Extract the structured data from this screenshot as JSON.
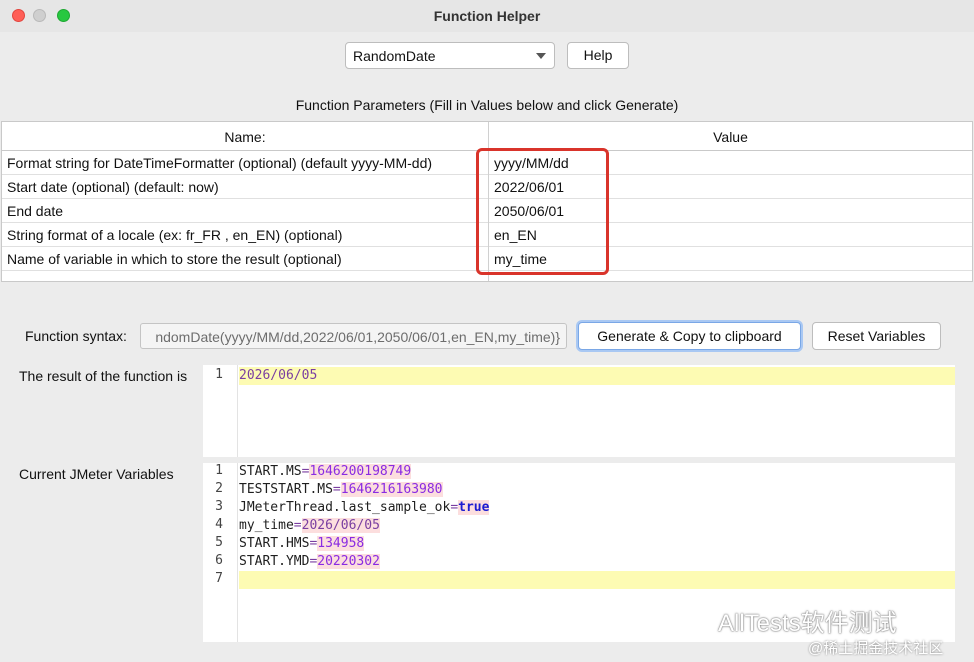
{
  "window": {
    "title": "Function Helper"
  },
  "function_select": {
    "value": "RandomDate"
  },
  "buttons": {
    "help": "Help",
    "generate": "Generate & Copy to clipboard",
    "reset": "Reset Variables"
  },
  "params": {
    "caption": "Function Parameters (Fill in Values below and click Generate)",
    "header_name": "Name:",
    "header_value": "Value",
    "rows": [
      {
        "name": "Format string for DateTimeFormatter (optional) (default yyyy-MM-dd)",
        "value": "yyyy/MM/dd"
      },
      {
        "name": "Start date (optional) (default: now)",
        "value": "2022/06/01"
      },
      {
        "name": "End date",
        "value": "2050/06/01"
      },
      {
        "name": "String format of a locale (ex: fr_FR , en_EN) (optional)",
        "value": "en_EN"
      },
      {
        "name": "Name of variable in which to store the result (optional)",
        "value": "my_time"
      }
    ]
  },
  "syntax": {
    "label": "Function syntax:",
    "value": "ndomDate(yyyy/MM/dd,2022/06/01,2050/06/01,en_EN,my_time)}"
  },
  "result": {
    "label": "The result of the function is",
    "lines": [
      {
        "num": "1",
        "text": "2026/06/05"
      }
    ]
  },
  "variables": {
    "label": "Current JMeter Variables",
    "lines": [
      {
        "num": "1",
        "key": "START.MS",
        "value": "1646200198749"
      },
      {
        "num": "2",
        "key": "TESTSTART.MS",
        "value": "1646216163980"
      },
      {
        "num": "3",
        "key": "JMeterThread.last_sample_ok",
        "value": "true"
      },
      {
        "num": "4",
        "key": "my_time",
        "value": "2026/06/05"
      },
      {
        "num": "5",
        "key": "START.HMS",
        "value": "134958"
      },
      {
        "num": "6",
        "key": "START.YMD",
        "value": "20220302"
      },
      {
        "num": "7",
        "key": "",
        "value": ""
      }
    ],
    "equals": "="
  },
  "watermark": {
    "main": "AllTests软件测试",
    "sub": "@稀土掘金技术社区"
  }
}
